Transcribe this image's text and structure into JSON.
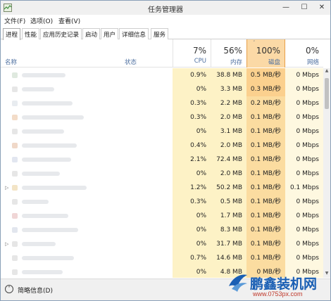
{
  "window": {
    "title": "任务管理器"
  },
  "menu": [
    "文件(F)",
    "选项(O)",
    "查看(V)"
  ],
  "tabs": [
    "进程",
    "性能",
    "应用历史记录",
    "启动",
    "用户",
    "详细信息",
    "服务"
  ],
  "header": {
    "name": "名称",
    "status": "状态",
    "cpu": {
      "pct": "7%",
      "label": "CPU"
    },
    "mem": {
      "pct": "56%",
      "label": "内存"
    },
    "disk": {
      "pct": "100%",
      "label": "磁盘"
    },
    "net": {
      "pct": "0%",
      "label": "网络"
    }
  },
  "rows": [
    {
      "cpu": "0.9%",
      "mem": "38.8 MB",
      "disk": "0.5 MB/秒",
      "net": "0 Mbps"
    },
    {
      "cpu": "0%",
      "mem": "3.3 MB",
      "disk": "0.3 MB/秒",
      "net": "0 Mbps"
    },
    {
      "cpu": "0.3%",
      "mem": "2.2 MB",
      "disk": "0.2 MB/秒",
      "net": "0 Mbps"
    },
    {
      "cpu": "0.3%",
      "mem": "2.0 MB",
      "disk": "0.1 MB/秒",
      "net": "0 Mbps"
    },
    {
      "cpu": "0%",
      "mem": "3.1 MB",
      "disk": "0.1 MB/秒",
      "net": "0 Mbps"
    },
    {
      "cpu": "0.4%",
      "mem": "2.0 MB",
      "disk": "0.1 MB/秒",
      "net": "0 Mbps"
    },
    {
      "cpu": "2.1%",
      "mem": "72.4 MB",
      "disk": "0.1 MB/秒",
      "net": "0 Mbps"
    },
    {
      "cpu": "0%",
      "mem": "2.0 MB",
      "disk": "0.1 MB/秒",
      "net": "0 Mbps"
    },
    {
      "cpu": "1.2%",
      "mem": "50.2 MB",
      "disk": "0.1 MB/秒",
      "net": "0.1 Mbps"
    },
    {
      "cpu": "0.3%",
      "mem": "0.5 MB",
      "disk": "0.1 MB/秒",
      "net": "0 Mbps"
    },
    {
      "cpu": "0%",
      "mem": "1.7 MB",
      "disk": "0.1 MB/秒",
      "net": "0 Mbps"
    },
    {
      "cpu": "0%",
      "mem": "8.3 MB",
      "disk": "0.1 MB/秒",
      "net": "0 Mbps"
    },
    {
      "cpu": "0%",
      "mem": "31.7 MB",
      "disk": "0.1 MB/秒",
      "net": "0 Mbps"
    },
    {
      "cpu": "0.7%",
      "mem": "14.6 MB",
      "disk": "0.1 MB/秒",
      "net": "0 Mbps"
    },
    {
      "cpu": "0%",
      "mem": "4.8 MB",
      "disk": "0 MB/秒",
      "net": "0 Mbps"
    }
  ],
  "footer": {
    "label": "简略信息(D)"
  },
  "watermark": {
    "brand": "鹏鑫装机网",
    "url": "www.0753px.com"
  },
  "colors": {
    "disk_header": "#fbd9a6",
    "disk_cell_high": "#fbdca0",
    "cell_yellow": "#fdf2c6",
    "cell_light": "#fef8e0",
    "accent": "#4d6fa0"
  }
}
